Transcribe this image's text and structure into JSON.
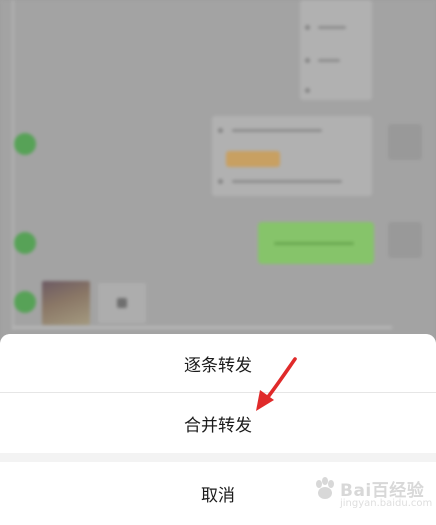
{
  "action_sheet": {
    "options": [
      {
        "label": "逐条转发"
      },
      {
        "label": "合并转发"
      }
    ],
    "cancel": {
      "label": "取消"
    }
  },
  "watermark": {
    "text": "Bai百经验",
    "sub": "jingyan.baidu.com"
  },
  "colors": {
    "overlay": "#9e9e9e",
    "select_check": "#57a257",
    "sent_bubble": "#86c46a",
    "annotation_arrow": "#e02a2a"
  },
  "icons": {
    "select_check": "check-circle-icon",
    "arrow": "red-arrow-annotation",
    "watermark": "baidu-paw-icon"
  }
}
